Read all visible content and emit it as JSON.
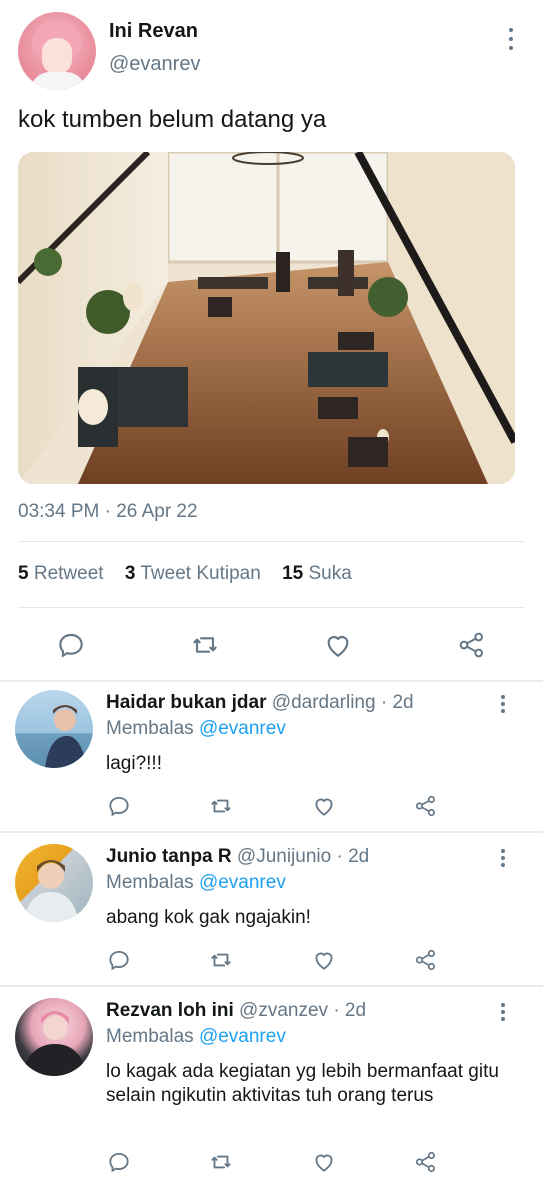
{
  "tweet": {
    "display_name": "Ini Revan",
    "handle": "@evanrev",
    "text": "kok tumben belum datang ya",
    "timestamp": "03:34 PM · 26 Apr 22",
    "stats": {
      "retweet_count": "5",
      "retweet_label": "Retweet",
      "quote_count": "3",
      "quote_label": "Tweet Kutipan",
      "like_count": "15",
      "like_label": "Suka"
    }
  },
  "replies": [
    {
      "name": "Haidar bukan jdar",
      "handle": "@dardarling",
      "time": "· 2d",
      "replying_prefix": "Membalas",
      "replying_to": "@evanrev",
      "text": "lagi?!!!"
    },
    {
      "name": "Junio tanpa R",
      "handle": "@Junijunio",
      "time": "· 2d",
      "replying_prefix": "Membalas",
      "replying_to": "@evanrev",
      "text": "abang kok gak ngajakin!"
    },
    {
      "name": "Rezvan loh ini",
      "handle": "@zvanzev",
      "time": "· 2d",
      "replying_prefix": "Membalas",
      "replying_to": "@evanrev",
      "text": "lo kagak ada kegiatan yg lebih bermanfaat gitu selain ngikutin aktivitas tuh orang terus"
    }
  ],
  "icons": [
    "reply-icon",
    "retweet-icon",
    "like-icon",
    "share-icon",
    "more-icon"
  ],
  "colors": {
    "text_primary": "#14171a",
    "text_secondary": "#657786",
    "mention": "#1da1f2",
    "divider": "#e1e8ed"
  }
}
